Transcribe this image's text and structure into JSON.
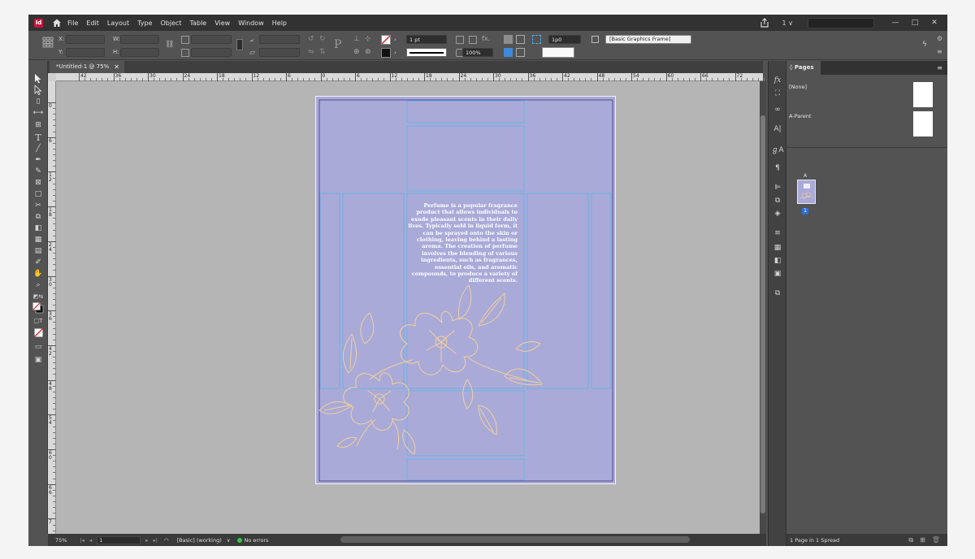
{
  "menubar": {
    "app_badge": "Id",
    "menus": [
      "File",
      "Edit",
      "Layout",
      "Type",
      "Object",
      "Table",
      "View",
      "Window",
      "Help"
    ],
    "workspace": "1 ∨",
    "window_controls": [
      "—",
      "□",
      "✕"
    ]
  },
  "control_panel": {
    "x_label": "X:",
    "y_label": "Y:",
    "w_label": "W:",
    "h_label": "H:",
    "stroke_weight": "1 pt",
    "opacity": "100%",
    "gutter": "1p0",
    "object_style": "[Basic Graphics Frame]"
  },
  "document": {
    "tab_label": "*Untitled-1 @ 75%",
    "tab_close": "✕"
  },
  "ruler": {
    "h_labels": [
      "42",
      "36",
      "30",
      "24",
      "18",
      "12",
      "6",
      "0",
      "6",
      "12",
      "18",
      "24",
      "30",
      "36",
      "42",
      "48",
      "54",
      "60",
      "66",
      "72"
    ],
    "v_labels": [
      "0",
      "6",
      "1\n2",
      "1\n8",
      "2\n4",
      "3\n0",
      "3\n6",
      "4\n2",
      "4\n8",
      "5\n4",
      "6\n0",
      "6\n6",
      "7"
    ]
  },
  "page_content": {
    "body_copy": "Perfume is a popular fragrance product that allows individuals to exude pleasant scents in their daily lives. Typically sold in liquid form, it can be sprayed onto the skin or clothing, leaving behind a lasting aroma. The creation of perfume involves the blending of various ingredients, such as fragrances, essential oils, and aromatic compounds, to produce a variety of different scents.",
    "page_color": "#a9aad8",
    "guide_color": "#5bb4e6",
    "floral_color": "#f3cf9a"
  },
  "status": {
    "zoom": "75%",
    "page": "1",
    "style": "[Basic] (working)",
    "preflight": "No errors"
  },
  "pages_panel": {
    "title": "Pages",
    "none_parent": "[None]",
    "a_parent": "A-Parent",
    "page_marker": "A",
    "page_number": "1",
    "footer": "1 Page in 1 Spread"
  }
}
